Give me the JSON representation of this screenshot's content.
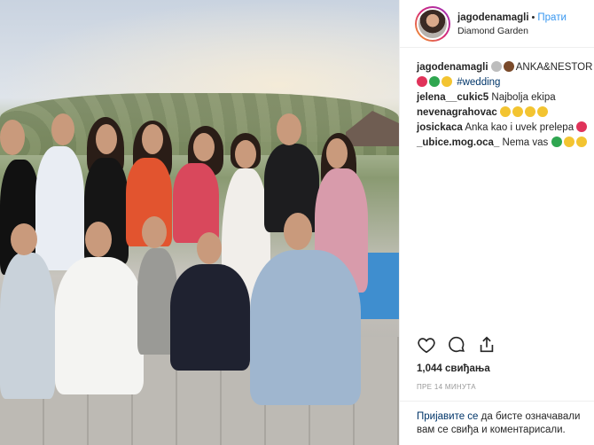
{
  "post": {
    "username": "jagodenamagli",
    "separator": "•",
    "follow_label": "Прати",
    "location": "Diamond Garden",
    "caption_user": "jagodenamagli",
    "caption_text": "ANKA&NESTOR",
    "hashtag": "#wedding",
    "comments": [
      {
        "user": "jelena__cukic5",
        "text": "Najbolja ekipa"
      },
      {
        "user": "nevenagrahovac",
        "text": ""
      },
      {
        "user": "josickaca",
        "text": "Anka kao i uvek prelepa"
      },
      {
        "user": "_ubice.mog.oca_",
        "text": "Nema vas"
      }
    ],
    "likes": "1,044 свиђања",
    "time_ago": "ПРЕ 14 МИНУТА",
    "login_link": "Пријавите се",
    "login_text_1": " да бисте означавали",
    "login_text_2": "вам се свиђа и коментарисали."
  },
  "icons": {
    "like": "heart-icon",
    "comment": "comment-icon",
    "share": "share-icon"
  },
  "colors": {
    "link_blue": "#3897f0",
    "hashtag_blue": "#003569",
    "muted": "#999999"
  }
}
